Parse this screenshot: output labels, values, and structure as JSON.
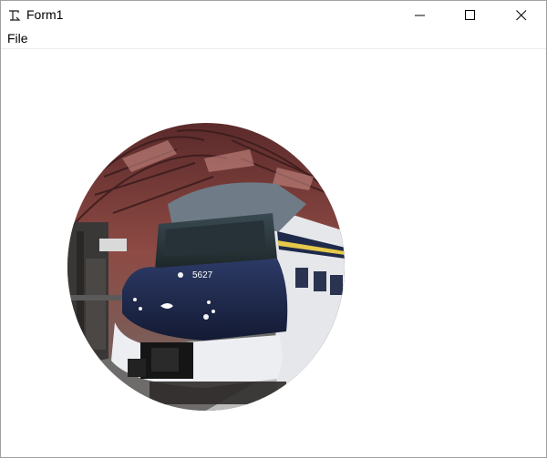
{
  "window": {
    "title": "Form1",
    "controls": {
      "minimize": "minimize-icon",
      "maximize": "maximize-icon",
      "close": "close-icon"
    }
  },
  "menu": {
    "items": [
      {
        "label": "File"
      }
    ]
  },
  "picture": {
    "shape": "circle",
    "subject": "train",
    "train_number": "5627",
    "colors": {
      "train_body": "#1f2a4a",
      "train_stripe": "#e8e8ea",
      "roof": "#8a3a3a",
      "accent": "#e6c84a"
    }
  }
}
